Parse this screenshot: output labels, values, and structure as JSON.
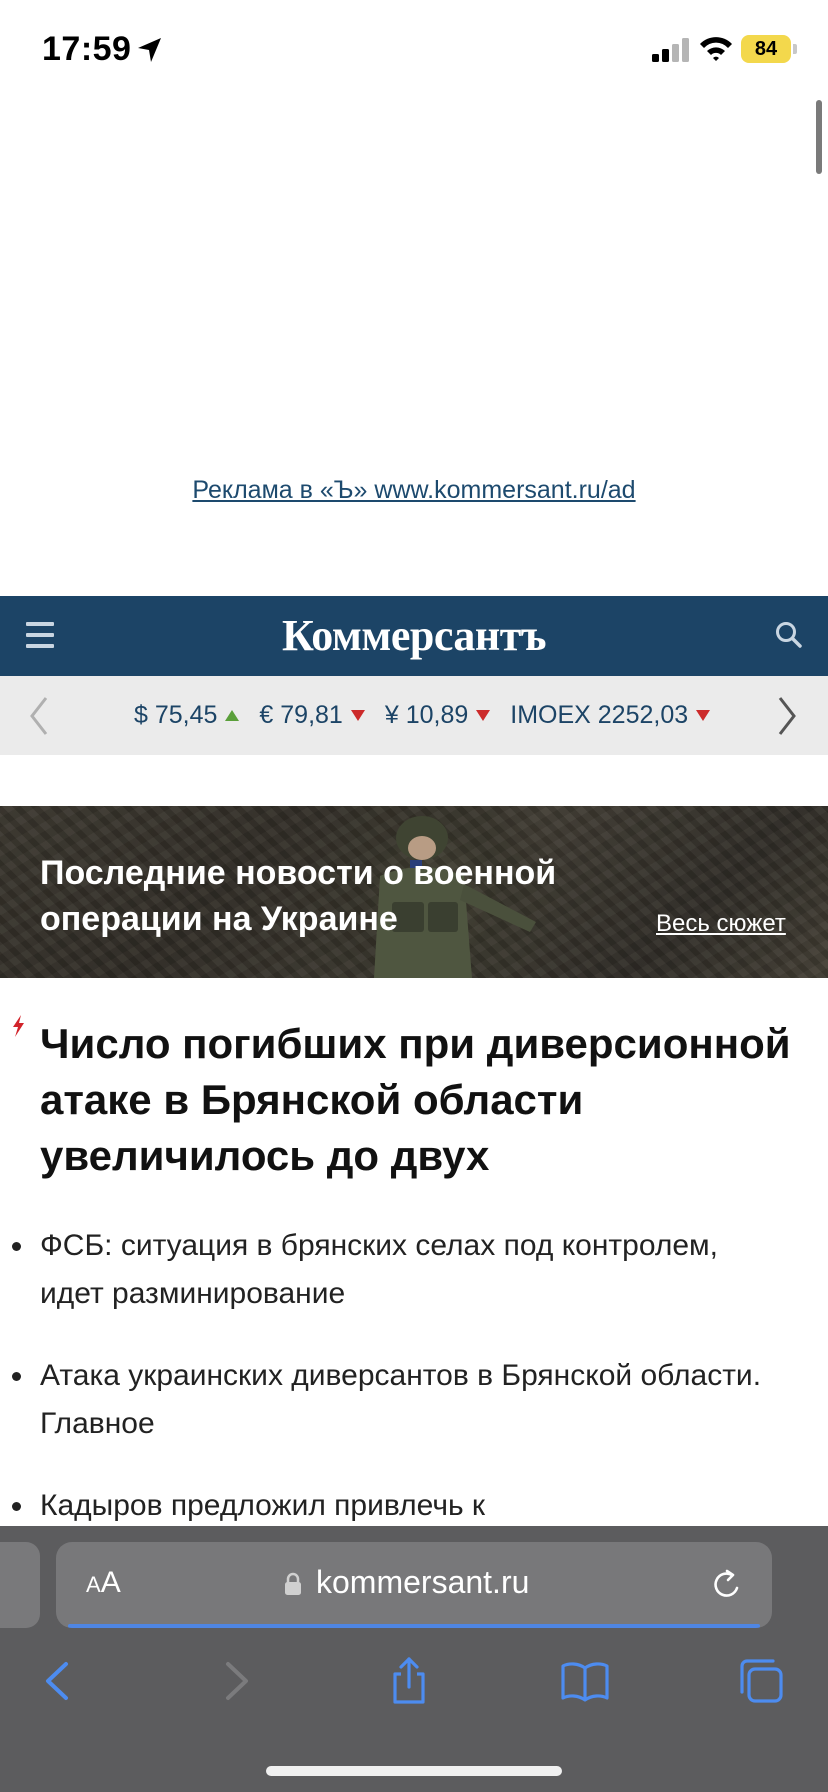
{
  "status_bar": {
    "time": "17:59",
    "battery": "84"
  },
  "ad": {
    "link_text": "Реклама в «Ъ» www.kommersant.ru/ad"
  },
  "header": {
    "logo": "Коммерсантъ",
    "brand_color": "#1c4466"
  },
  "ticker": {
    "items": [
      {
        "label": "$ 75,45",
        "trend": "up"
      },
      {
        "label": "€ 79,81",
        "trend": "down"
      },
      {
        "label": "¥ 10,89",
        "trend": "down"
      },
      {
        "label": "IMOEX 2252,03",
        "trend": "down"
      }
    ]
  },
  "banner": {
    "title": "Последние новости о военной операции на Украине",
    "link": "Весь сюжет"
  },
  "article": {
    "headline": "Число погибших при диверсионной атаке в Брянской области увеличилось до двух",
    "bullets": [
      "ФСБ: ситуация в брянских селах под контролем, идет разминирование",
      "Атака украинских диверсантов в Брянской области. Главное",
      "Кадыров предложил привлечь к"
    ]
  },
  "browser": {
    "aa_label_small": "A",
    "aa_label_large": "A",
    "url": "kommersant.ru"
  }
}
